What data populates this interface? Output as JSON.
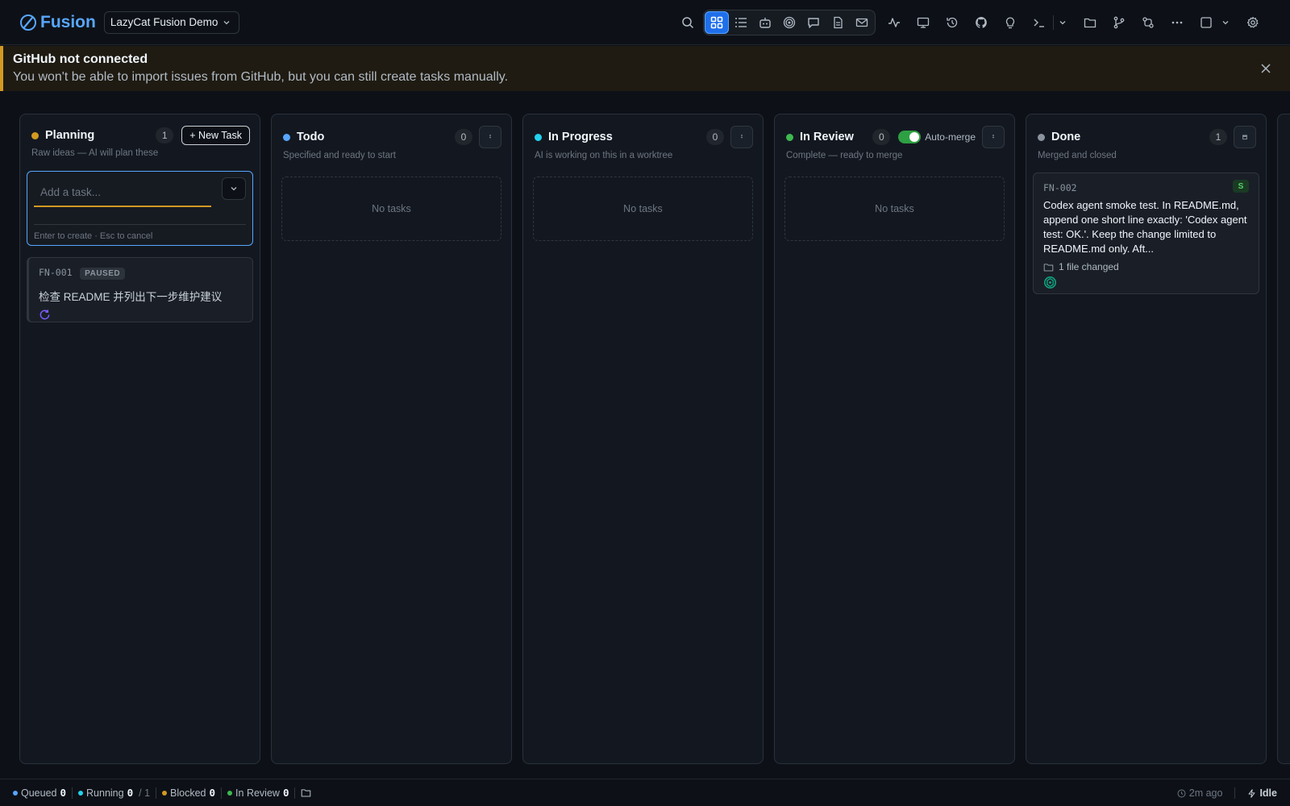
{
  "app": {
    "name": "Fusion",
    "project": "LazyCat Fusion Demo",
    "accent": "#58a6ff"
  },
  "toolbar": {
    "icons": [
      "search-icon",
      "board-view-icon",
      "list-view-icon",
      "agents-icon",
      "missions-icon",
      "chat-icon",
      "document-icon",
      "mail-icon",
      "activity-icon",
      "monitor-icon",
      "history-icon",
      "github-icon",
      "ideas-icon",
      "terminal-icon",
      "files-icon",
      "git-branch-icon",
      "workflow-icon",
      "more-icon",
      "layout-icon",
      "settings-icon"
    ],
    "active_view": "board-view-icon"
  },
  "banner": {
    "title": "GitHub not connected",
    "text": "You won't be able to import issues from GitHub, but you can still create tasks manually.",
    "color": "#d29922"
  },
  "columns": [
    {
      "id": "planning",
      "title": "Planning",
      "count": "1",
      "subtitle": "Raw ideas — AI will plan these",
      "color": "#d29922",
      "new_task_label": "+ New Task"
    },
    {
      "id": "todo",
      "title": "Todo",
      "count": "0",
      "subtitle": "Specified and ready to start",
      "color": "#58a6ff",
      "empty_label": "No tasks"
    },
    {
      "id": "in-progress",
      "title": "In Progress",
      "count": "0",
      "subtitle": "AI is working on this in a worktree",
      "color": "#22d3ee",
      "empty_label": "No tasks"
    },
    {
      "id": "in-review",
      "title": "In Review",
      "count": "0",
      "subtitle": "Complete — ready to merge",
      "color": "#3fb950",
      "empty_label": "No tasks",
      "automerge_label": "Auto-merge",
      "automerge_on": true
    },
    {
      "id": "done",
      "title": "Done",
      "count": "1",
      "subtitle": "Merged and closed",
      "color": "#8b949e"
    }
  ],
  "quick_add": {
    "placeholder": "Add a task...",
    "hint": "Enter to create · Esc to cancel"
  },
  "cards": {
    "planning": {
      "id": "FN-001",
      "badge": "PAUSED",
      "title": "检查 README 并列出下一步维护建议"
    },
    "done": {
      "id": "FN-002",
      "badge": "S",
      "title": "Codex agent smoke test. In README.md, append one short line exactly: 'Codex agent test: OK.'. Keep the change limited to README.md only. Aft...",
      "files_changed": "1 file changed"
    }
  },
  "footer": {
    "queued_label": "Queued",
    "queued": "0",
    "running_label": "Running",
    "running": "0",
    "running_of": "/ 1",
    "blocked_label": "Blocked",
    "blocked": "0",
    "review_label": "In Review",
    "review": "0",
    "time": "2m ago",
    "status": "Idle"
  }
}
